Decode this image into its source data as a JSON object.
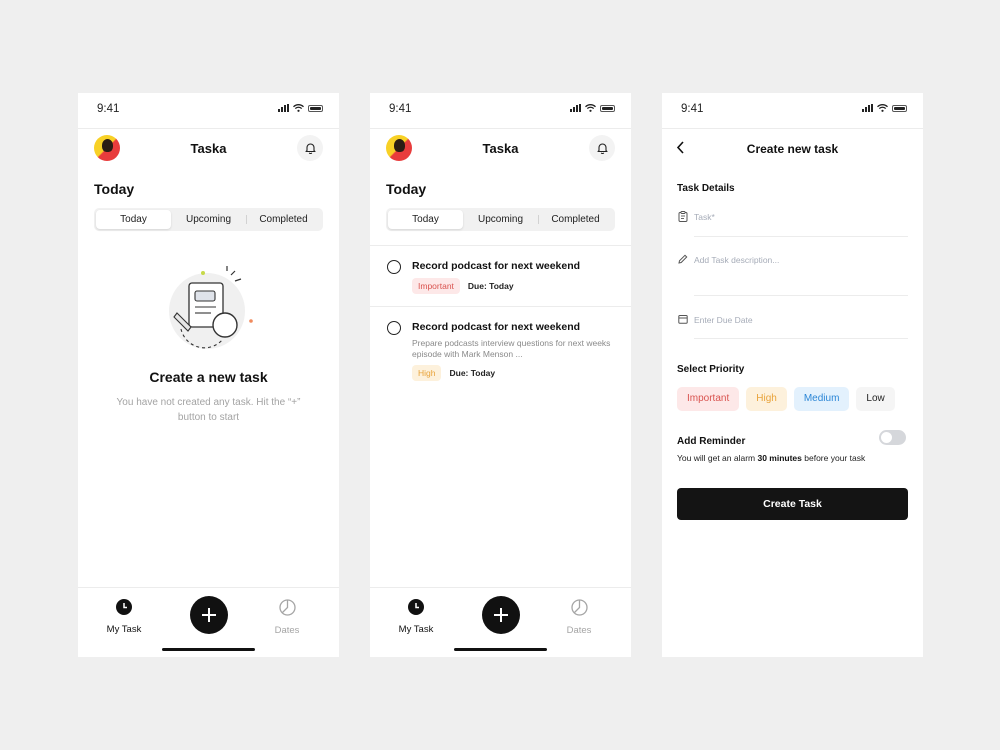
{
  "status_time": "9:41",
  "app_name": "Taska",
  "section_title": "Today",
  "tabs": [
    "Today",
    "Upcoming",
    "Completed"
  ],
  "empty_state": {
    "heading": "Create a new task",
    "message": "You have not created any task. Hit the “+” button to start"
  },
  "tasks": [
    {
      "title": "Record podcast for next weekend",
      "description": "",
      "priority": "Important",
      "due": "Due: Today"
    },
    {
      "title": "Record podcast for next weekend",
      "description": "Prepare podcasts interview questions for next weeks episode with Mark Menson ...",
      "priority": "High",
      "due": "Due: Today"
    }
  ],
  "tabbar": {
    "my_task": "My Task",
    "dates": "Dates"
  },
  "create": {
    "title": "Create new task",
    "task_details_label": "Task Details",
    "task_placeholder": "Task*",
    "description_placeholder": "Add Task description...",
    "due_date_placeholder": "Enter Due Date",
    "priority_label": "Select Priority",
    "priorities": [
      "Important",
      "High",
      "Medium",
      "Low"
    ],
    "reminder_label": "Add Reminder",
    "reminder_text_before": "You will get an alarm ",
    "reminder_text_bold": "30 minutes",
    "reminder_text_after": " before your task",
    "submit": "Create Task"
  },
  "colors": {
    "important": "#d9534f",
    "high": "#e8a33a",
    "medium": "#2b86d6",
    "primary": "#111111"
  },
  "icons": [
    "signal-icon",
    "wifi-icon",
    "battery-icon",
    "bell-icon",
    "plus-icon",
    "clock-icon",
    "pie-chart-icon",
    "back-arrow-icon",
    "clipboard-icon",
    "pencil-icon",
    "calendar-icon"
  ]
}
